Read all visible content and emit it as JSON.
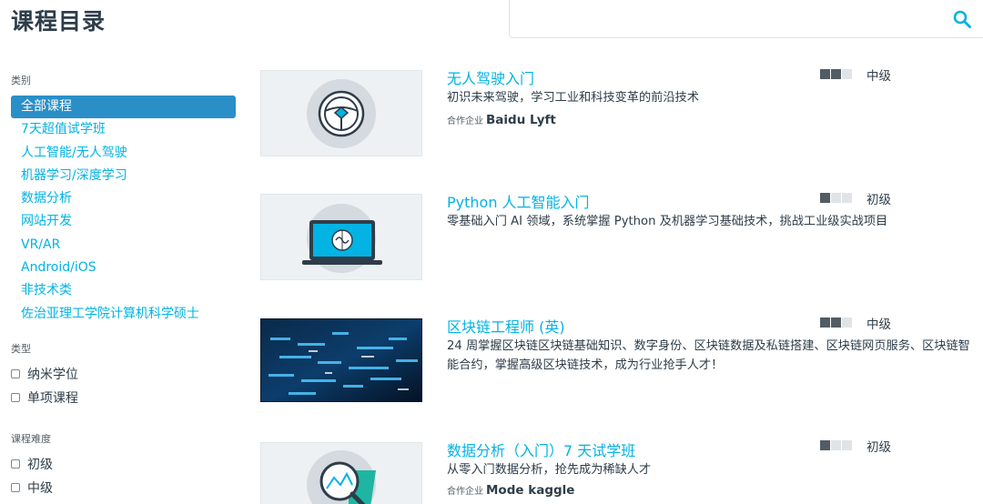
{
  "header": {
    "title": "课程目录",
    "search_placeholder": ""
  },
  "sidebar": {
    "category_heading": "类别",
    "categories": [
      {
        "label": "全部课程",
        "active": true
      },
      {
        "label": "7天超值试学班",
        "active": false
      },
      {
        "label": "人工智能/无人驾驶",
        "active": false
      },
      {
        "label": "机器学习/深度学习",
        "active": false
      },
      {
        "label": "数据分析",
        "active": false
      },
      {
        "label": "网站开发",
        "active": false
      },
      {
        "label": "VR/AR",
        "active": false
      },
      {
        "label": "Android/iOS",
        "active": false
      },
      {
        "label": "非技术类",
        "active": false
      },
      {
        "label": "佐治亚理工学院计算机科学硕士",
        "active": false
      }
    ],
    "type_heading": "类型",
    "types": [
      "纳米学位",
      "单项课程"
    ],
    "difficulty_heading": "课程难度",
    "difficulties": [
      "初级",
      "中级"
    ]
  },
  "courses": [
    {
      "title": "无人驾驶入门",
      "description": "初识未来驾驶，学习工业和科技变革的前沿技术",
      "partner_label": "合作企业",
      "partner": "Baidu Lyft",
      "level": "中级",
      "level_filled": 2,
      "thumb_icon": "steering-wheel-icon"
    },
    {
      "title": "Python 人工智能入门",
      "description": "零基础入门 AI 领域，系统掌握 Python 及机器学习基础技术，挑战工业级实战项目",
      "partner_label": "",
      "partner": "",
      "level": "初级",
      "level_filled": 1,
      "thumb_icon": "laptop-brain-icon"
    },
    {
      "title": "区块链工程师 (英)",
      "description": "24 周掌握区块链区块链基础知识、数字身份、区块链数据及私链搭建、区块链网页服务、区块链智能合约，掌握高级区块链技术，成为行业抢手人才！",
      "partner_label": "",
      "partner": "",
      "level": "中级",
      "level_filled": 2,
      "thumb_icon": "blockchain-image"
    },
    {
      "title": "数据分析（入门）7 天试学班",
      "description": "从零入门数据分析，抢先成为稀缺人才",
      "partner_label": "合作企业",
      "partner": "Mode kaggle",
      "level": "初级",
      "level_filled": 1,
      "thumb_icon": "magnifier-chart-icon"
    }
  ],
  "colors": {
    "accent": "#02b3e4",
    "active_bg": "#2a8fc7",
    "text": "#2e3d49"
  }
}
